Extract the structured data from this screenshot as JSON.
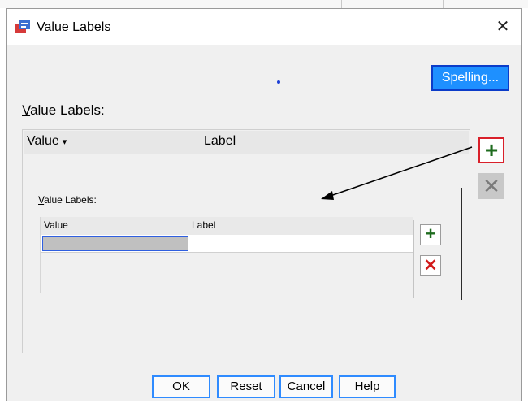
{
  "window": {
    "title": "Value Labels",
    "close_symbol": "✕"
  },
  "buttons": {
    "spelling": "Spelling...",
    "ok": "OK",
    "reset": "Reset",
    "cancel": "Cancel",
    "help": "Help"
  },
  "value_labels_section": {
    "label_first": "V",
    "label_rest": "alue Labels:",
    "columns": {
      "value": "Value",
      "label": "Label"
    },
    "value_caret": "▾"
  },
  "inner_table": {
    "label_first": "V",
    "label_rest": "alue Labels:",
    "columns": {
      "value": "Value",
      "label": "Label"
    },
    "rows": [
      {
        "value": "",
        "label": ""
      }
    ]
  },
  "icons": {
    "add": "+",
    "remove": "✕"
  },
  "colors": {
    "accent": "#1e90ff",
    "add_green": "#1e6b1e",
    "remove_red": "#d21a1a",
    "highlight_border": "#d9202a"
  }
}
